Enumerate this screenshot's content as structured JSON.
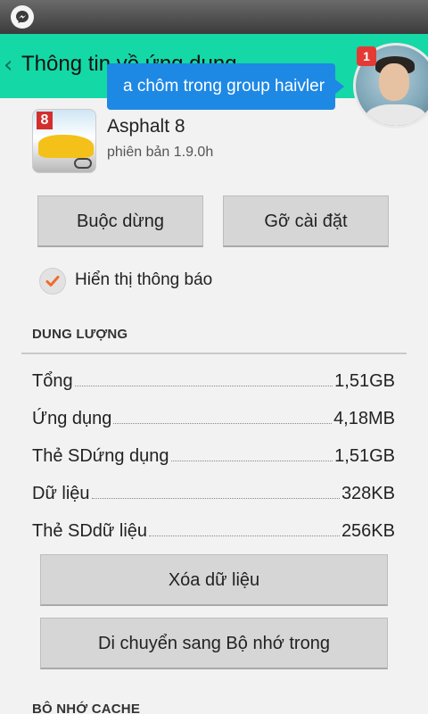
{
  "actionbar": {
    "title": "Thông tin về ứng dụng"
  },
  "chat": {
    "message": "a chôm trong group haivler",
    "badge_count": "1"
  },
  "app": {
    "name": "Asphalt 8",
    "version": "phiên bản 1.9.0h",
    "icon_number": "8"
  },
  "buttons": {
    "force_stop": "Buộc dừng",
    "uninstall": "Gỡ cài đặt",
    "clear_data": "Xóa dữ liệu",
    "move_storage": "Di chuyển sang Bộ nhớ trong"
  },
  "notifications": {
    "label": "Hiển thị thông báo",
    "checked": true
  },
  "storage": {
    "header": "DUNG LƯỢNG",
    "rows": [
      {
        "label": "Tổng",
        "value": "1,51GB"
      },
      {
        "label": "Ứng dụng",
        "value": "4,18MB"
      },
      {
        "label": "Thẻ SDứng dụng",
        "value": "1,51GB"
      },
      {
        "label": "Dữ liệu",
        "value": "328KB"
      },
      {
        "label": "Thẻ SDdữ liệu",
        "value": "256KB"
      }
    ]
  },
  "cache": {
    "header": "BỘ NHỚ CACHE"
  },
  "colors": {
    "actionbar": "#14d8a6",
    "bubble": "#1e88e5",
    "badge": "#e53935",
    "check": "#f26b2a"
  }
}
